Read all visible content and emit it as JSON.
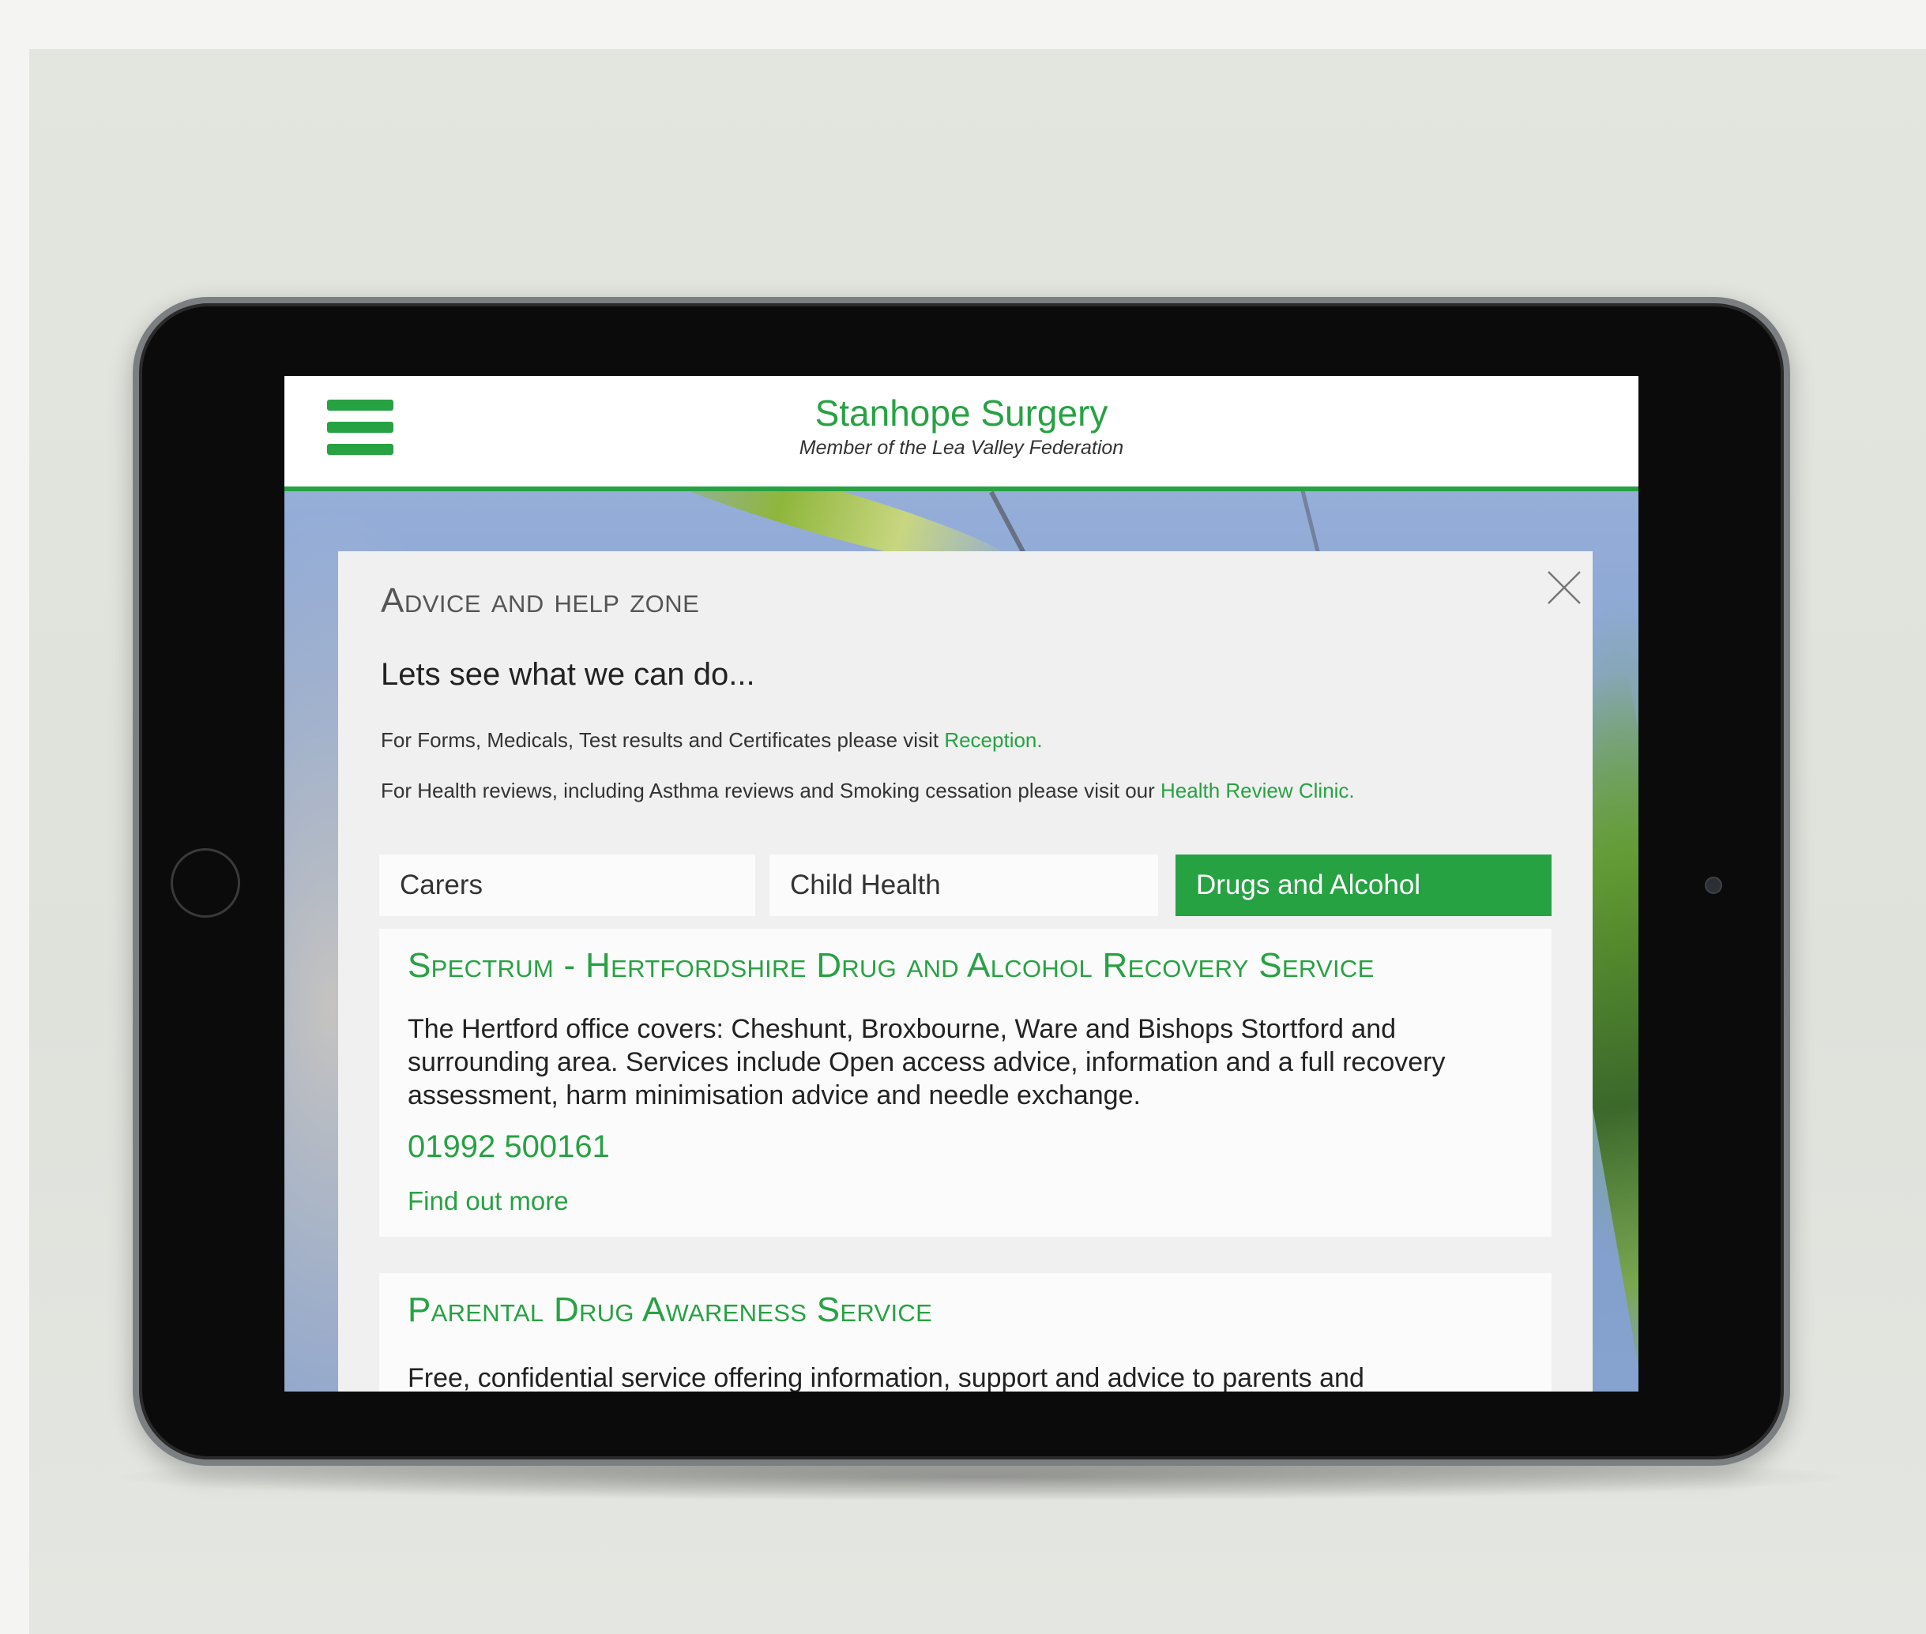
{
  "header": {
    "title": "Stanhope Surgery",
    "subtitle": "Member of the Lea Valley Federation"
  },
  "modal": {
    "zone_title": "Advice and help zone",
    "intro": "Lets see what we can do...",
    "info1_text": "For Forms, Medicals, Test results and Certificates please visit ",
    "info1_link": "Reception.",
    "info2_text": "For Health reviews, including Asthma reviews and Smoking cessation please visit our ",
    "info2_link": "Health Review Clinic."
  },
  "tabs": [
    {
      "label": "Carers",
      "active": false
    },
    {
      "label": "Child Health",
      "active": false
    },
    {
      "label": "Drugs and Alcohol",
      "active": true
    }
  ],
  "cards": [
    {
      "title": "Spectrum - Hertfordshire Drug and Alcohol Recovery Service",
      "description": "The Hertford office covers: Cheshunt, Broxbourne, Ware and Bishops Stortford and surrounding area. Services include Open access advice, information and a full recovery assessment, harm minimisation advice and needle exchange.",
      "phone": "01992 500161",
      "link": "Find out more"
    },
    {
      "title": "Parental Drug Awareness Service",
      "description": "Free, confidential service offering information, support and advice to parents and"
    }
  ],
  "icons": {
    "menu": "hamburger-icon",
    "close": "close-icon"
  },
  "colors": {
    "accent": "#27a243",
    "bezel": "#0b0b0b"
  }
}
